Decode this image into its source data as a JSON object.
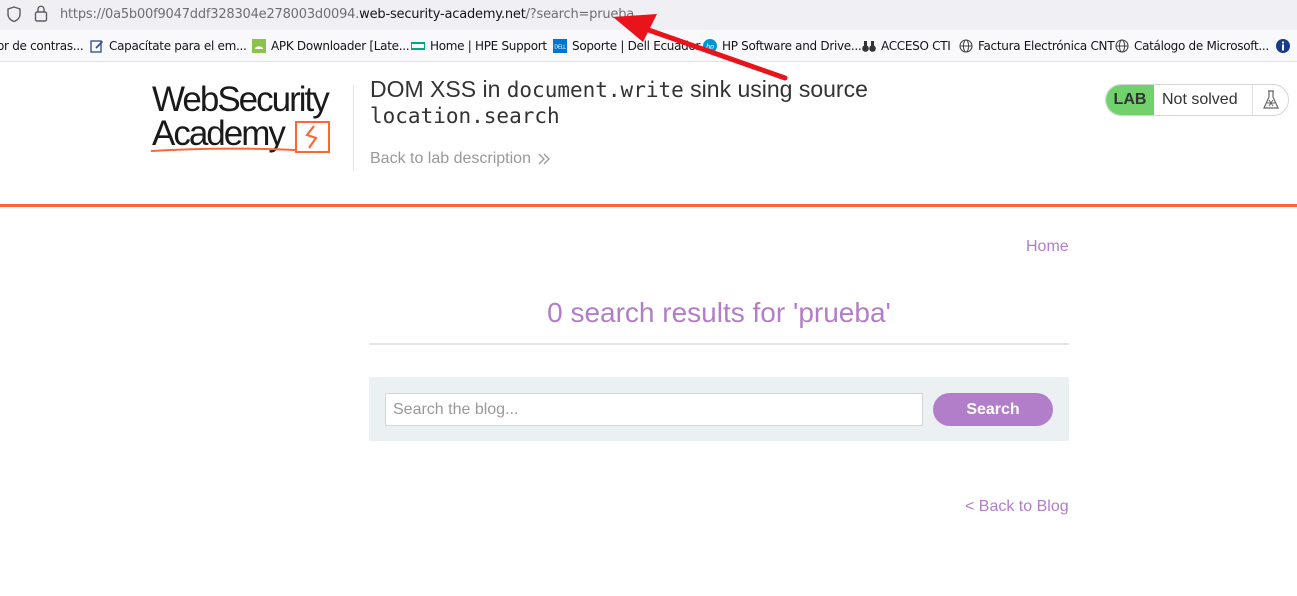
{
  "browser": {
    "url_prefix": "https://0a5b00f9047ddf328304e278003d0094.",
    "url_domain": "web-security-academy.net",
    "url_suffix": "/?search=prueba",
    "bookmarks": [
      {
        "label": "or de contras...",
        "icon": "none"
      },
      {
        "label": "Capacítate para el em...",
        "icon": "edit-icon"
      },
      {
        "label": "APK Downloader [Late...",
        "icon": "android-icon"
      },
      {
        "label": "Home | HPE Support",
        "icon": "hpe-icon"
      },
      {
        "label": "Soporte | Dell Ecuador",
        "icon": "dell-icon"
      },
      {
        "label": "HP Software and Drive...",
        "icon": "hp-icon"
      },
      {
        "label": "ACCESO CTI",
        "icon": "binoculars-icon"
      },
      {
        "label": "Factura Electrónica CNT",
        "icon": "globe-icon"
      },
      {
        "label": "Catálogo de Microsoft...",
        "icon": "globe-icon"
      },
      {
        "label": "",
        "icon": "info-icon"
      }
    ]
  },
  "header": {
    "logo_line1": "WebSecurity",
    "logo_line2": "Academy",
    "title_part1": "DOM XSS in ",
    "title_code1": "document.write",
    "title_part2": " sink using source ",
    "title_code2": "location.search",
    "back_link": "Back to lab description",
    "lab_badge": "LAB",
    "lab_status": "Not solved"
  },
  "main": {
    "home_link": "Home",
    "results_heading": "0 search results for 'prueba'",
    "search_placeholder": "Search the blog...",
    "search_button": "Search",
    "back_to_blog": "< Back to Blog"
  },
  "colors": {
    "accent_purple": "#b27ec9",
    "orange": "#ff6633",
    "lab_green": "#70d16d",
    "annotation_red": "#e8131b"
  }
}
